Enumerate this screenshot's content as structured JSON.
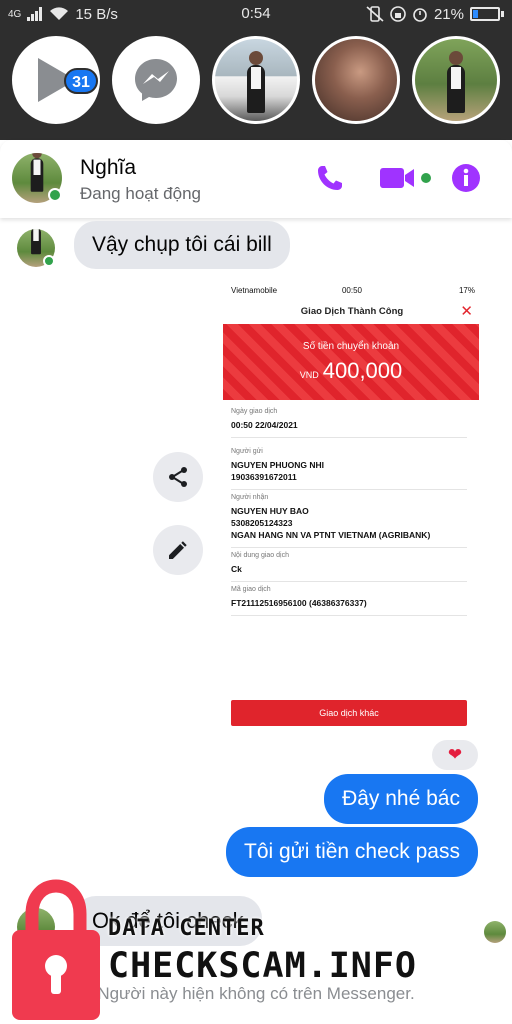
{
  "status_bar": {
    "network": "4G",
    "speed": "15 B/s",
    "time": "0:54",
    "battery": "21%"
  },
  "chat_heads": {
    "unread_count": "31"
  },
  "header": {
    "contact_name": "Nghĩa",
    "presence": "Đang hoạt động",
    "accent_color": "#a033ff"
  },
  "messages": {
    "incoming_1": "Vậy chụp tôi cái bill",
    "outgoing_1": "Đây nhé bác",
    "outgoing_2": "Tôi gửi tiền check pass",
    "incoming_2": "Ok để tôi check",
    "reaction": "❤"
  },
  "receipt": {
    "carrier": "Vietnamobile",
    "time": "00:50",
    "battery": "17%",
    "title": "Giao Dịch Thành Công",
    "amount_label": "Số tiền chuyển khoản",
    "currency": "VND",
    "amount": "400,000",
    "fields": [
      {
        "label": "Ngày giao dịch",
        "lines": [
          "00:50 22/04/2021"
        ]
      },
      {
        "label": "Người gửi",
        "lines": [
          "NGUYEN PHUONG NHI",
          "19036391672011"
        ]
      },
      {
        "label": "Người nhận",
        "lines": [
          "NGUYEN HUY BAO",
          "5308205124323",
          "NGAN HANG NN VA PTNT VIETNAM (AGRIBANK)"
        ]
      },
      {
        "label": "Nội dung giao dịch",
        "lines": [
          "Ck"
        ]
      },
      {
        "label": "Mã giao dịch",
        "lines": [
          "FT21112516956100 (46386376337)"
        ]
      }
    ],
    "button_label": "Giao dịch khác"
  },
  "footer": {
    "unavailable_text": "Người này hiện không có trên Messenger."
  },
  "watermark": {
    "line1": "DATA CENTER",
    "line2": "CHECKSCAM.INFO"
  },
  "colors": {
    "messenger_blue": "#1877f2",
    "online_green": "#31a24c",
    "receipt_red": "#e0242c",
    "lock_red": "#f03a4f"
  }
}
